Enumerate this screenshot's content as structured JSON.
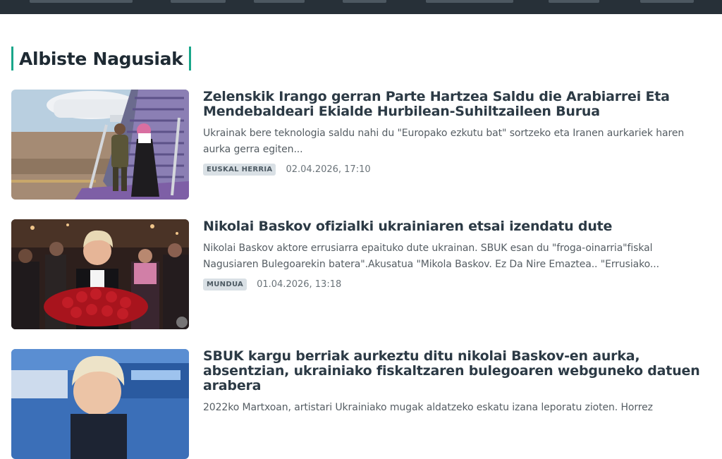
{
  "section": {
    "title": "Albiste Nagusiak"
  },
  "articles": [
    {
      "headline": "Zelenskik Irango gerran Parte Hartzea Saldu die Arabiarrei Eta Mendebaldeari Ekialde Hurbilean-Suhiltzaileen Burua",
      "summary": "Ukrainak bere teknologia saldu nahi du \"Europako ezkutu bat\" sortzeko eta Iranen aurkariek haren aurka gerra egiten...",
      "category": "EUSKAL HERRIA",
      "date": "02.04.2026, 17:10"
    },
    {
      "headline": "Nikolai Baskov ofizialki ukrainiaren etsai izendatu dute",
      "summary": "Nikolai Baskov aktore errusiarra epaituko dute ukrainan. SBUK esan du \"froga-oinarria\"fiskal Nagusiaren Bulegoarekin batera\".Akusatua \"Mikola Baskov. Ez Da Nire Emaztea.. \"Errusiako...",
      "category": "MUNDUA",
      "date": "01.04.2026, 13:18"
    },
    {
      "headline": "SBUK kargu berriak aurkeztu ditu nikolai Baskov-en aurka, absentzian, ukrainiako fiskaltzaren bulegoaren webguneko datuen arabera",
      "summary": "2022ko Martxoan, artistari Ukrainiako mugak aldatzeko eskatu izana leporatu zioten. Horrez"
    }
  ]
}
